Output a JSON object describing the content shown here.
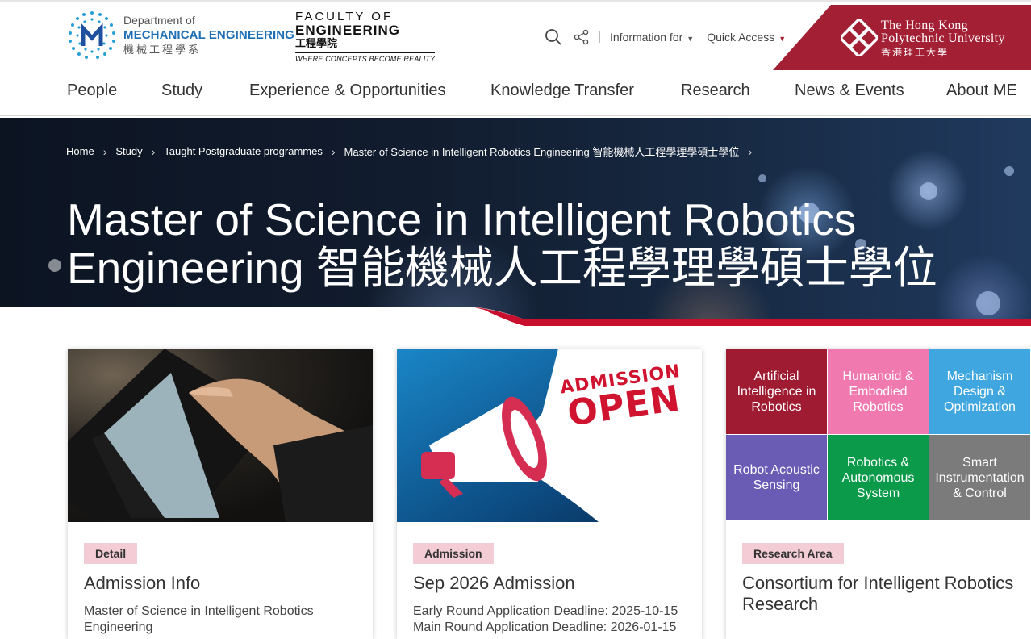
{
  "header": {
    "dept_line1": "Department of",
    "dept_line2": "MECHANICAL ENGINEERING",
    "dept_line3": "機械工程學系",
    "faculty_line1": "FACULTY OF",
    "faculty_line2": "ENGINEERING",
    "faculty_line3": "工程學院",
    "faculty_tagline": "WHERE CONCEPTS BECOME REALITY",
    "info_for": "Information for",
    "quick_access": "Quick Access",
    "university_line1": "The Hong Kong",
    "university_line2": "Polytechnic University",
    "university_line3": "香港理工大學"
  },
  "nav": [
    "People",
    "Study",
    "Experience & Opportunities",
    "Knowledge Transfer",
    "Research",
    "News & Events",
    "About ME"
  ],
  "breadcrumb": [
    "Home",
    "Study",
    "Taught Postgraduate programmes",
    "Master of Science in Intelligent Robotics Engineering 智能機械人工程學理學碩士學位"
  ],
  "hero": {
    "title": "Master of Science in Intelligent Robotics Engineering 智能機械人工程學理學碩士學位"
  },
  "cards": [
    {
      "tag": "Detail",
      "title": "Admission Info",
      "desc": "Master of Science in Intelligent Robotics Engineering"
    },
    {
      "tag": "Admission",
      "title": "Sep 2026 Admission",
      "desc_line1": "Early Round Application Deadline: 2025-10-15",
      "desc_line2": "Main Round Application Deadline: 2026-01-15",
      "banner_line1": "ADMISSION",
      "banner_line2": "OPEN"
    },
    {
      "tag": "Research Area",
      "title": "Consortium for Intelligent Robotics Research"
    }
  ],
  "research_tiles": [
    {
      "label": "Artificial Intelligence in Robotics",
      "color": "#9e1b32"
    },
    {
      "label": "Humanoid & Embodied Robotics",
      "color": "#f07ab0"
    },
    {
      "label": "Mechanism Design & Optimization",
      "color": "#3fa6df"
    },
    {
      "label": "Robot Acoustic Sensing",
      "color": "#6a5bb5"
    },
    {
      "label": "Robotics & Autonomous System",
      "color": "#0a9a4a"
    },
    {
      "label": "Smart Instrumentation & Control",
      "color": "#7b7b7b"
    }
  ],
  "colors": {
    "brand_red": "#a31f34",
    "dept_blue": "#1f6fb5",
    "tag_pink": "#f3ccd6"
  },
  "icons": [
    "search-icon",
    "share-icon",
    "caret-down-icon",
    "chevron-right-icon",
    "polyu-logo",
    "dept-logo"
  ]
}
